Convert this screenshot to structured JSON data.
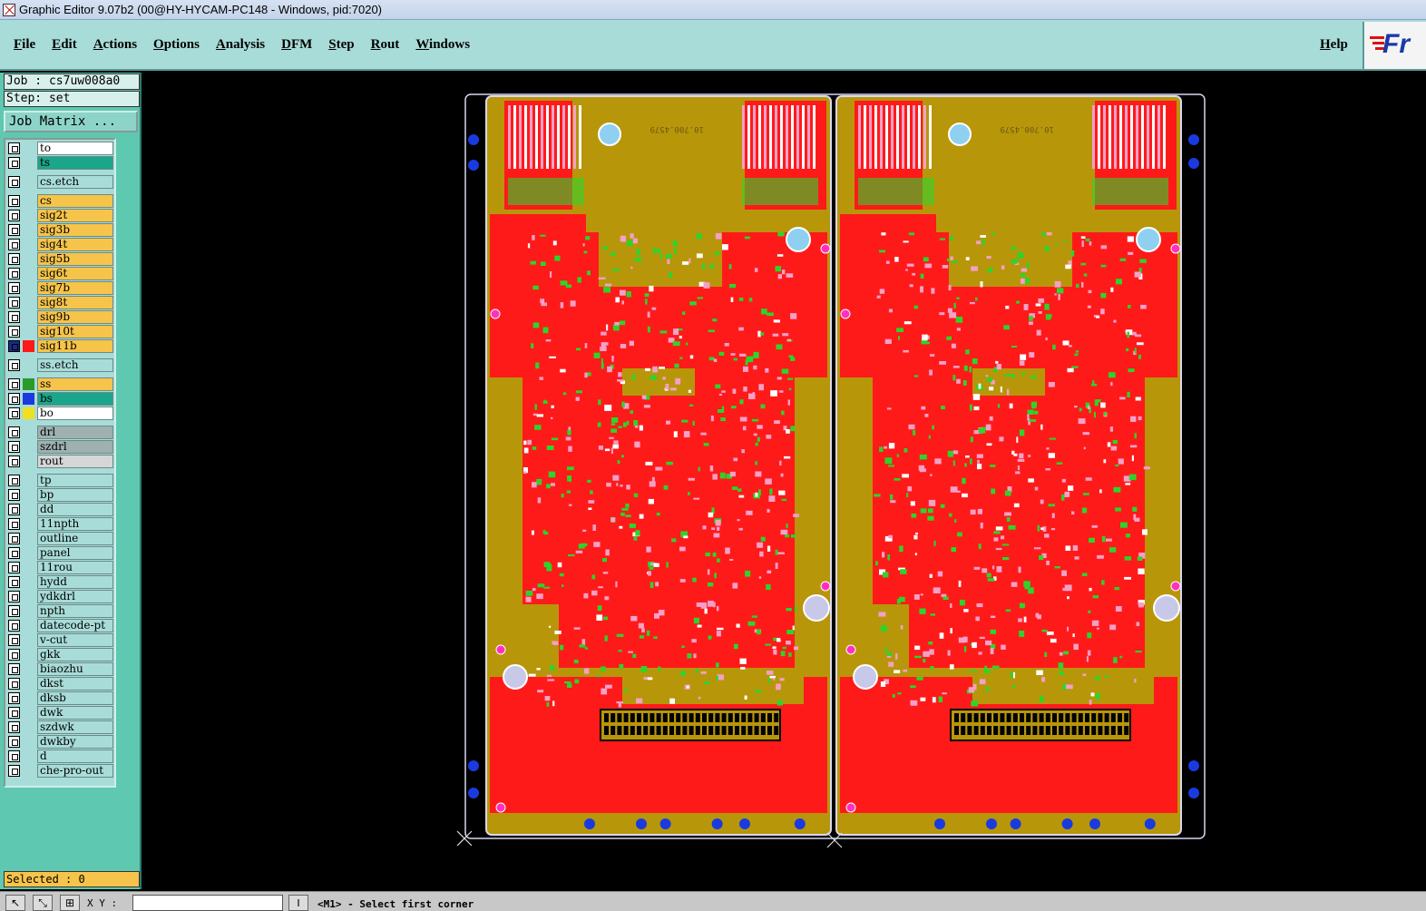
{
  "window": {
    "title": "Graphic Editor 9.07b2 (00@HY-HYCAM-PC148 - Windows, pid:7020)"
  },
  "menu": {
    "items": [
      "File",
      "Edit",
      "Actions",
      "Options",
      "Analysis",
      "DFM",
      "Step",
      "Rout",
      "Windows"
    ],
    "help": "Help"
  },
  "logo": {
    "text": "Fr"
  },
  "job": {
    "label": "Job : cs7uw008a0",
    "step": "Step: set",
    "matrix_button": "Job Matrix ..."
  },
  "layers": [
    {
      "name": "to",
      "bg": "#ffffff",
      "swatch": ""
    },
    {
      "name": "ts",
      "bg": "#1aa68a",
      "swatch": ""
    },
    {
      "name": "cs.etch",
      "bg": "#a8dcd8",
      "swatch": ""
    },
    {
      "name": "cs",
      "bg": "#f6c44a",
      "swatch": ""
    },
    {
      "name": "sig2t",
      "bg": "#f6c44a",
      "swatch": ""
    },
    {
      "name": "sig3b",
      "bg": "#f6c44a",
      "swatch": ""
    },
    {
      "name": "sig4t",
      "bg": "#f6c44a",
      "swatch": ""
    },
    {
      "name": "sig5b",
      "bg": "#f6c44a",
      "swatch": ""
    },
    {
      "name": "sig6t",
      "bg": "#f6c44a",
      "swatch": ""
    },
    {
      "name": "sig7b",
      "bg": "#f6c44a",
      "swatch": ""
    },
    {
      "name": "sig8t",
      "bg": "#f6c44a",
      "swatch": ""
    },
    {
      "name": "sig9b",
      "bg": "#f6c44a",
      "swatch": ""
    },
    {
      "name": "sig10t",
      "bg": "#f6c44a",
      "swatch": ""
    },
    {
      "name": "sig11b",
      "bg": "#f6c44a",
      "swatch": "#ff1a1a"
    },
    {
      "name": "ss.etch",
      "bg": "#a8dcd8",
      "swatch": ""
    },
    {
      "name": "ss",
      "bg": "#f6c44a",
      "swatch": "#2a9a2a"
    },
    {
      "name": "bs",
      "bg": "#1aa68a",
      "swatch": "#1a3ae0"
    },
    {
      "name": "bo",
      "bg": "#ffffff",
      "swatch": "#f0e020"
    },
    {
      "name": "drl",
      "bg": "#9eb0b0",
      "swatch": ""
    },
    {
      "name": "szdrl",
      "bg": "#9eb0b0",
      "swatch": ""
    },
    {
      "name": "rout",
      "bg": "#d6d6d6",
      "swatch": ""
    },
    {
      "name": "tp",
      "bg": "#a8dcd8",
      "swatch": ""
    },
    {
      "name": "bp",
      "bg": "#a8dcd8",
      "swatch": ""
    },
    {
      "name": "dd",
      "bg": "#a8dcd8",
      "swatch": ""
    },
    {
      "name": "11npth",
      "bg": "#a8dcd8",
      "swatch": ""
    },
    {
      "name": "outline",
      "bg": "#a8dcd8",
      "swatch": ""
    },
    {
      "name": "panel",
      "bg": "#a8dcd8",
      "swatch": ""
    },
    {
      "name": "11rou",
      "bg": "#a8dcd8",
      "swatch": ""
    },
    {
      "name": "hydd",
      "bg": "#a8dcd8",
      "swatch": ""
    },
    {
      "name": "ydkdrl",
      "bg": "#a8dcd8",
      "swatch": ""
    },
    {
      "name": "npth",
      "bg": "#a8dcd8",
      "swatch": ""
    },
    {
      "name": "datecode-pt",
      "bg": "#a8dcd8",
      "swatch": ""
    },
    {
      "name": "v-cut",
      "bg": "#a8dcd8",
      "swatch": ""
    },
    {
      "name": "gkk",
      "bg": "#a8dcd8",
      "swatch": ""
    },
    {
      "name": "biaozhu",
      "bg": "#a8dcd8",
      "swatch": ""
    },
    {
      "name": "dkst",
      "bg": "#a8dcd8",
      "swatch": ""
    },
    {
      "name": "dksb",
      "bg": "#a8dcd8",
      "swatch": ""
    },
    {
      "name": "dwk",
      "bg": "#a8dcd8",
      "swatch": ""
    },
    {
      "name": "szdwk",
      "bg": "#a8dcd8",
      "swatch": ""
    },
    {
      "name": "dwkby",
      "bg": "#a8dcd8",
      "swatch": ""
    },
    {
      "name": "d",
      "bg": "#a8dcd8",
      "swatch": ""
    },
    {
      "name": "che-pro-out",
      "bg": "#a8dcd8",
      "swatch": ""
    }
  ],
  "selected": {
    "text": "Selected : 0"
  },
  "status": {
    "xy_label": "X Y :",
    "coord_value": "",
    "prompt": "<M1> - Select first corner"
  },
  "pcb": {
    "board_label": "10.700.4579",
    "colors": {
      "copper": "#b8960a",
      "signal": "#ff1a1a",
      "silkscreen": "#2bd52b",
      "pad": "#f4a0c8",
      "via": "#1a3ae0",
      "outline": "#d8d8f0"
    }
  }
}
